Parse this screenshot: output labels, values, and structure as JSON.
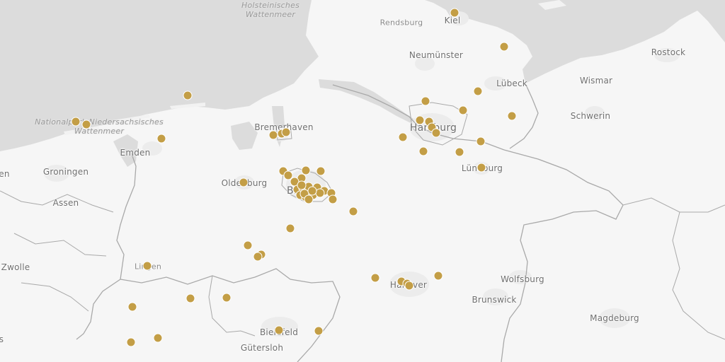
{
  "colors": {
    "water": "#dcdcdc",
    "land": "#f6f6f6",
    "border": "#a9a9a9",
    "urban": "#ececec",
    "marker": "#c39e46",
    "marker_stroke": "#ffffff"
  },
  "labels": {
    "wadden_north": [
      "Holsteinisches",
      "Wattenmeer"
    ],
    "wadden_west": [
      "Nationalpark Niedersachsisches",
      "Wattenmeer"
    ],
    "rendsburg": "Rendsburg",
    "kiel": "Kiel",
    "neumunster": "Neumünster",
    "rostock": "Rostock",
    "lubeck": "Lübeck",
    "wismar": "Wismar",
    "schwerin": "Schwerin",
    "hamburg": "Hamburg",
    "bremerhaven": "Bremerhaven",
    "emden": "Emden",
    "groningen": "Groningen",
    "leer_partial": "en",
    "assen": "Assen",
    "oldenburg": "Oldenburg",
    "bremen": "Bremen",
    "luneburg": "Lüneburg",
    "zwolle": "Zwolle",
    "lingen": "Lingen",
    "hanover": "Hanover",
    "wolfsburg": "Wolfsburg",
    "brunswick": "Brunswick",
    "magdeburg": "Magdeburg",
    "bielefeld": "Bielefeld",
    "gutersloh": "Gütersloh",
    "edge_partial": "s"
  },
  "markers": {
    "icon": "location-dot-icon",
    "count": 62
  }
}
